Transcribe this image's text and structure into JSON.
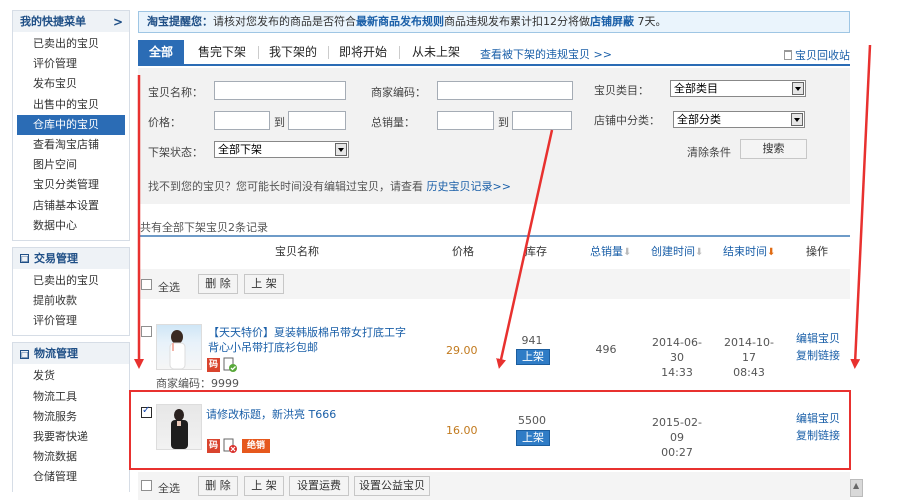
{
  "sidebar": {
    "groups": [
      {
        "title": "我的快捷菜单",
        "arrow": ">",
        "items": [
          "已卖出的宝贝",
          "评价管理",
          "发布宝贝",
          "出售中的宝贝",
          "仓库中的宝贝",
          "查看淘宝店铺",
          "图片空间",
          "宝贝分类管理",
          "店铺基本设置",
          "数据中心"
        ],
        "active": 4
      },
      {
        "title": "交易管理",
        "toggle": "□",
        "items": [
          "已卖出的宝贝",
          "提前收款",
          "评价管理"
        ]
      },
      {
        "title": "物流管理",
        "toggle": "□",
        "items": [
          "发货",
          "物流工具",
          "物流服务",
          "我要寄快递",
          "物流数据",
          "仓储管理"
        ]
      }
    ]
  },
  "notice": {
    "prefix": "淘宝提醒您：",
    "text1": "请核对您发布的商品是否符合",
    "link1": "最新商品发布规则",
    "text2": "商品违规发布累计扣12分将做",
    "link2": "店铺屏蔽",
    "text3": " 7天。"
  },
  "tabs": {
    "items": [
      "全部",
      "售完下架",
      "我下架的",
      "即将开始",
      "从未上架"
    ],
    "violation_link": "查看被下架的违规宝贝 >>",
    "recycle": "宝贝回收站"
  },
  "search": {
    "name_label": "宝贝名称：",
    "code_label": "商家编码：",
    "category_label": "宝贝类目：",
    "category_value": "全部类目",
    "price_label": "价格：",
    "to1": "到",
    "sales_label": "总销量：",
    "to2": "到",
    "shop_cat_label": "店铺中分类：",
    "shop_cat_value": "全部分类",
    "status_label": "下架状态：",
    "status_value": "全部下架",
    "clear": "清除条件",
    "search_btn": "搜索",
    "tip": "找不到您的宝贝？您可能长时间没有编辑过宝贝，请查看 ",
    "tip_link": "历史宝贝记录>>"
  },
  "count_text": "共有全部下架宝贝2条记录",
  "table": {
    "headers": {
      "name": "宝贝名称",
      "price": "价格",
      "stock": "库存",
      "sales": "总销量",
      "created": "创建时间",
      "ended": "结束时间",
      "ops": "操作"
    }
  },
  "toolbar_top": {
    "select_all": "全选",
    "delete": "删 除",
    "shelve": "上 架"
  },
  "toolbar_bottom": {
    "select_all": "全选",
    "delete": "删 除",
    "shelve": "上 架",
    "freight": "设置运费",
    "charity": "设置公益宝贝"
  },
  "rows": [
    {
      "title_line1": "【天天特价】夏装韩版棉吊带女打底工字",
      "title_line2": "背心小吊带打底衫包邮",
      "badge_code": "码",
      "merchant_code": "商家编码：9999",
      "price": "29.00",
      "stock": "941",
      "shelve": "上架",
      "sales": "496",
      "created_date": "2014-06-30",
      "created_time": "14:33",
      "ended_date": "2014-10-17",
      "ended_time": "08:43",
      "edit": "编辑宝贝",
      "copy": "复制链接",
      "checked": false
    },
    {
      "title_line1": "请修改标题，新洪亮 T666",
      "badge_code": "码",
      "badge_sold": "绝销",
      "price": "16.00",
      "stock": "5500",
      "shelve": "上架",
      "created_date": "2015-02-09",
      "created_time": "00:27",
      "edit": "编辑宝贝",
      "copy": "复制链接",
      "checked": true
    }
  ],
  "colors": {
    "accent": "#2b6cb5",
    "highlight": "#e8312f",
    "price": "#c27a1e",
    "link": "#1a5fa8"
  }
}
